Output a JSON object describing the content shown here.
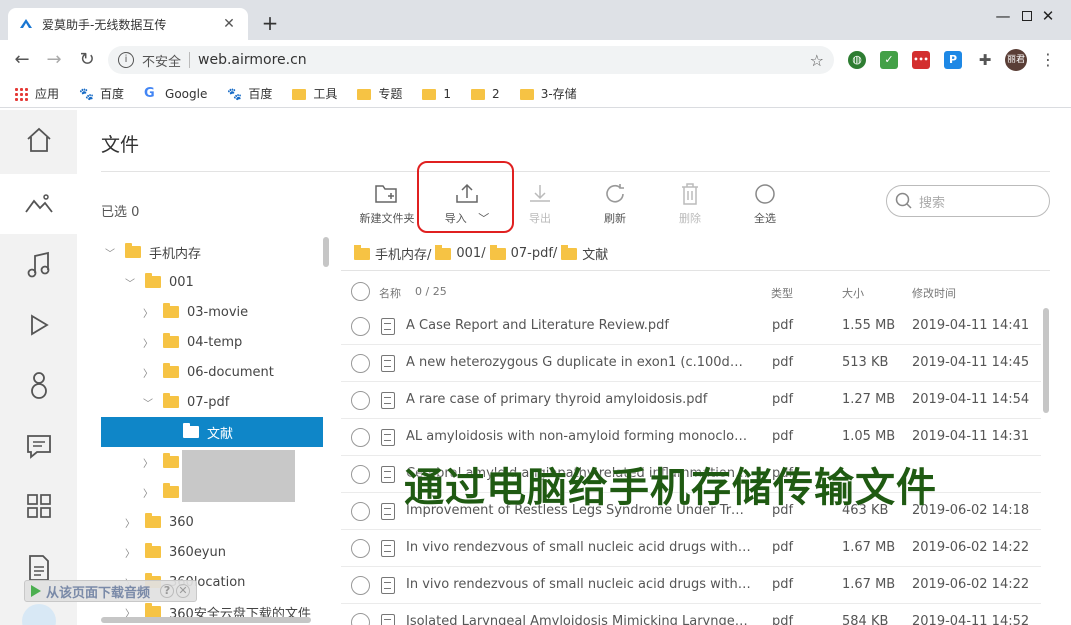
{
  "browser": {
    "tab_title": "爱莫助手-无线数据互传",
    "insecure_label": "不安全",
    "url": "web.airmore.cn",
    "avatar_text": "丽君"
  },
  "bookmarks": [
    {
      "label": "应用",
      "icon": "apps-icon"
    },
    {
      "label": "百度",
      "icon": "baidu-icon"
    },
    {
      "label": "Google",
      "icon": "google-icon"
    },
    {
      "label": "百度",
      "icon": "baidu-icon"
    },
    {
      "label": "工具",
      "icon": "folder-icon"
    },
    {
      "label": "专题",
      "icon": "folder-icon"
    },
    {
      "label": "1",
      "icon": "folder-icon"
    },
    {
      "label": "2",
      "icon": "folder-icon"
    },
    {
      "label": "3-存储",
      "icon": "folder-icon"
    }
  ],
  "page": {
    "title": "文件",
    "selected_label": "已选 0",
    "search_placeholder": "搜索"
  },
  "toolbar": {
    "new_folder": "新建文件夹",
    "import": "导入",
    "export": "导出",
    "refresh": "刷新",
    "delete": "删除",
    "select_all": "全选"
  },
  "tree": [
    {
      "label": "手机内存"
    },
    {
      "label": "001"
    },
    {
      "label": "03-movie"
    },
    {
      "label": "04-temp"
    },
    {
      "label": "06-document"
    },
    {
      "label": "07-pdf"
    },
    {
      "label": "文献"
    },
    {
      "label": ""
    },
    {
      "label": ""
    },
    {
      "label": "360"
    },
    {
      "label": "360eyun"
    },
    {
      "label": "360location"
    },
    {
      "label": "360安全云盘下载的文件"
    }
  ],
  "breadcrumb": [
    "手机内存/",
    "001/",
    "07-pdf/",
    "文献"
  ],
  "table": {
    "col_name": "名称",
    "count": "0 / 25",
    "col_type": "类型",
    "col_size": "大小",
    "col_date": "修改时间",
    "rows": [
      {
        "name": "A Case Report and Literature Review.pdf",
        "type": "pdf",
        "size": "1.55 MB",
        "date": "2019-04-11 14:41"
      },
      {
        "name": "A new heterozygous G duplicate in exon1 (c.100dup...",
        "type": "pdf",
        "size": "513 KB",
        "date": "2019-04-11 14:45"
      },
      {
        "name": "A rare case of primary thyroid amyloidosis.pdf",
        "type": "pdf",
        "size": "1.27 MB",
        "date": "2019-04-11 14:54"
      },
      {
        "name": "AL amyloidosis with non-amyloid forming monoclon...",
        "type": "pdf",
        "size": "1.05 MB",
        "date": "2019-04-11 14:31"
      },
      {
        "name": "Cerebral amyloid angiopathy related inflammation.pdf",
        "type": "pdf",
        "size": "",
        "date": ""
      },
      {
        "name": "Improvement of Restless Legs Syndrome Under Trea...",
        "type": "pdf",
        "size": "463 KB",
        "date": "2019-06-02 14:18"
      },
      {
        "name": "In vivo rendezvous of small nucleic acid drugs with c...",
        "type": "pdf",
        "size": "1.67 MB",
        "date": "2019-06-02 14:22"
      },
      {
        "name": "In vivo rendezvous of small nucleic acid drugs with c...",
        "type": "pdf",
        "size": "1.67 MB",
        "date": "2019-06-02 14:22"
      },
      {
        "name": "Isolated Laryngeal Amyloidosis Mimicking Laryngeal...",
        "type": "pdf",
        "size": "584 KB",
        "date": "2019-04-11 14:52"
      }
    ]
  },
  "overlay_caption": "通过电脑给手机存储传输文件",
  "download_bar": "从该页面下载音频",
  "colors": {
    "accent": "#0f86c8",
    "highlight": "#e02020",
    "folder": "#f6c344",
    "caption": "#1f5a12"
  }
}
